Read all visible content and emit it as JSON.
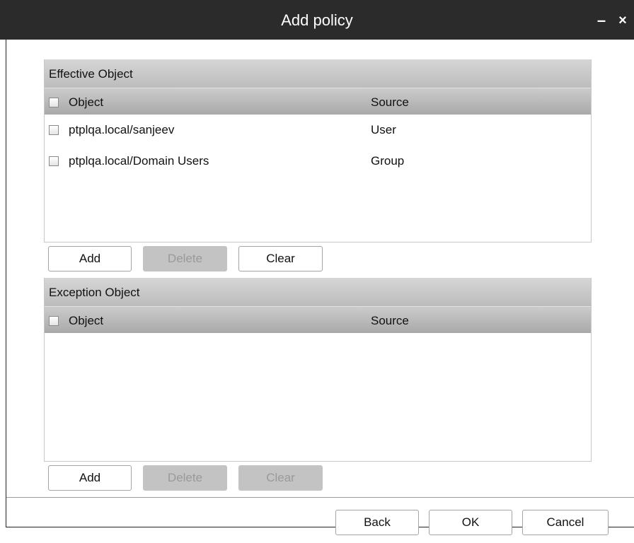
{
  "window": {
    "title": "Add policy",
    "minimize_label": "–",
    "close_label": "×"
  },
  "effective": {
    "title": "Effective Object",
    "columns": {
      "object": "Object",
      "source": "Source"
    },
    "rows": [
      {
        "object": "ptplqa.local/sanjeev",
        "source": "User",
        "checked": false
      },
      {
        "object": "ptplqa.local/Domain Users",
        "source": "Group",
        "checked": false
      }
    ],
    "buttons": {
      "add": {
        "label": "Add",
        "enabled": true
      },
      "delete": {
        "label": "Delete",
        "enabled": false
      },
      "clear": {
        "label": "Clear",
        "enabled": true
      }
    }
  },
  "exception": {
    "title": "Exception Object",
    "columns": {
      "object": "Object",
      "source": "Source"
    },
    "rows": [],
    "buttons": {
      "add": {
        "label": "Add",
        "enabled": true
      },
      "delete": {
        "label": "Delete",
        "enabled": false
      },
      "clear": {
        "label": "Clear",
        "enabled": false
      }
    }
  },
  "footer": {
    "back_label": "Back",
    "ok_label": "OK",
    "cancel_label": "Cancel"
  }
}
